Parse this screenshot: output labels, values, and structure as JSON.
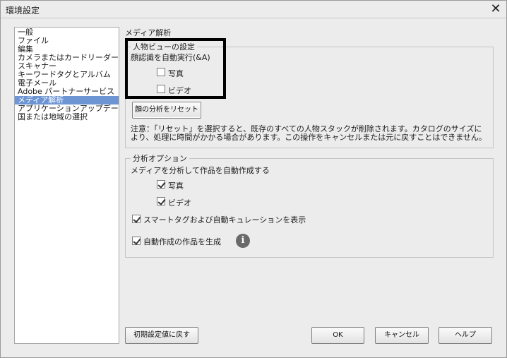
{
  "window": {
    "title": "環境設定",
    "close_glyph": "✕"
  },
  "categories": [
    "一般",
    "ファイル",
    "編集",
    "カメラまたはカードリーダー",
    "スキャナー",
    "キーワードタグとアルバム",
    "電子メール",
    "Adobe パートナーサービス",
    "メディア解析",
    "アプリケーションアップデート",
    "国または地域の選択"
  ],
  "selected_category": "メディア解析",
  "section_title": "メディア解析",
  "people_view": {
    "legend": "人物ビューの設定",
    "auto_run_label": "顔認識を自動実行(&A)",
    "photo": {
      "label": "写真",
      "checked": false
    },
    "video": {
      "label": "ビデオ",
      "checked": false
    },
    "reset_button": "顔の分析をリセット",
    "note": "注意：「リセット」を選択すると、既存のすべての人物スタックが削除されます。カタログのサイズにより、処理に時間がかかる場合があります。この操作をキャンセルまたは元に戻すことはできません。"
  },
  "analysis_options": {
    "legend": "分析オプション",
    "auto_create_label": "メディアを分析して作品を自動作成する",
    "photo": {
      "label": "写真",
      "checked": true
    },
    "video": {
      "label": "ビデオ",
      "checked": true
    },
    "smart_tags": {
      "label": "スマートタグおよび自動キュレーションを表示",
      "checked": true
    },
    "generate_auto": {
      "label": "自動作成の作品を生成",
      "checked": true
    }
  },
  "footer": {
    "reset_defaults": "初期設定値に戻す",
    "ok": "OK",
    "cancel": "キャンセル",
    "help": "ヘルプ"
  },
  "icons": {
    "info": "info-icon",
    "close": "close-icon"
  },
  "colors": {
    "selection": "#6d95d4",
    "highlight_border": "#000000"
  }
}
